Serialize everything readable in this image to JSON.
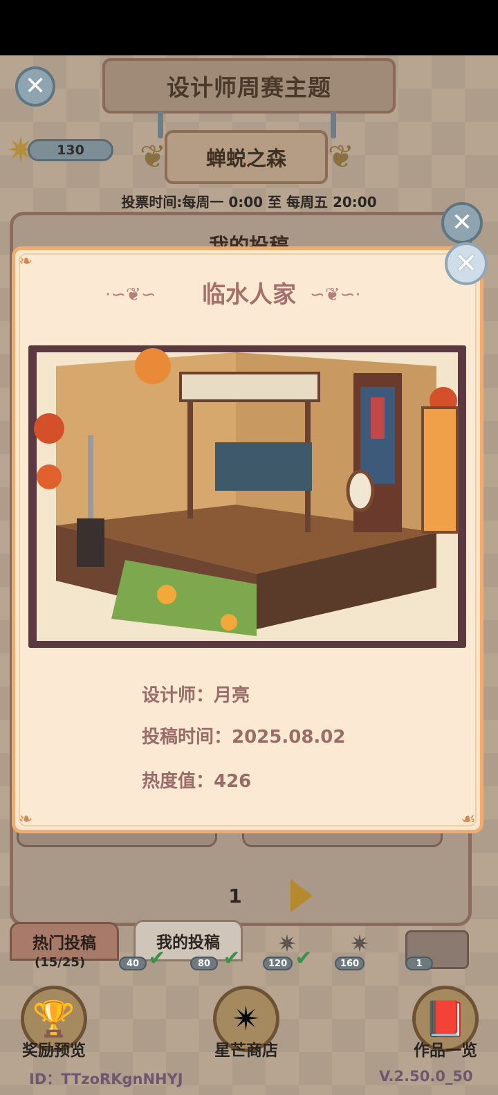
{
  "header": {
    "title": "设计师周赛主题",
    "theme": "蝉蜕之森",
    "vote_time": "投票时间:每周一 0:00 至 每周五 20:00",
    "star_count": "130"
  },
  "panel": {
    "title": "我的投稿",
    "page": "1"
  },
  "tabs": [
    {
      "label": "热门投稿"
    },
    {
      "label": "我的投稿"
    }
  ],
  "progress": {
    "count": "(15/25)",
    "milestones": [
      "40",
      "80",
      "120",
      "160",
      "1"
    ]
  },
  "bottom_nav": [
    {
      "label": "奖励预览"
    },
    {
      "label": "星芒商店"
    },
    {
      "label": "作品一览"
    }
  ],
  "footer": {
    "id": "ID：TTzoRKgnNHYJ",
    "version": "V.2.50.0_50"
  },
  "dialog": {
    "title": "临水人家",
    "designer": "设计师：月亮",
    "submit_time": "投稿时间：2025.08.02",
    "heat": "热度值：426"
  },
  "colors": {
    "dialog_bg": "#fbe9d4",
    "dialog_border": "#f0ad72",
    "title_color": "#a6706a",
    "info_color": "#9a6c68"
  },
  "icons": [
    "close-icon",
    "star-icon",
    "next-arrow-icon",
    "check-icon",
    "mail-icon",
    "book-icon",
    "trophy-icon"
  ]
}
